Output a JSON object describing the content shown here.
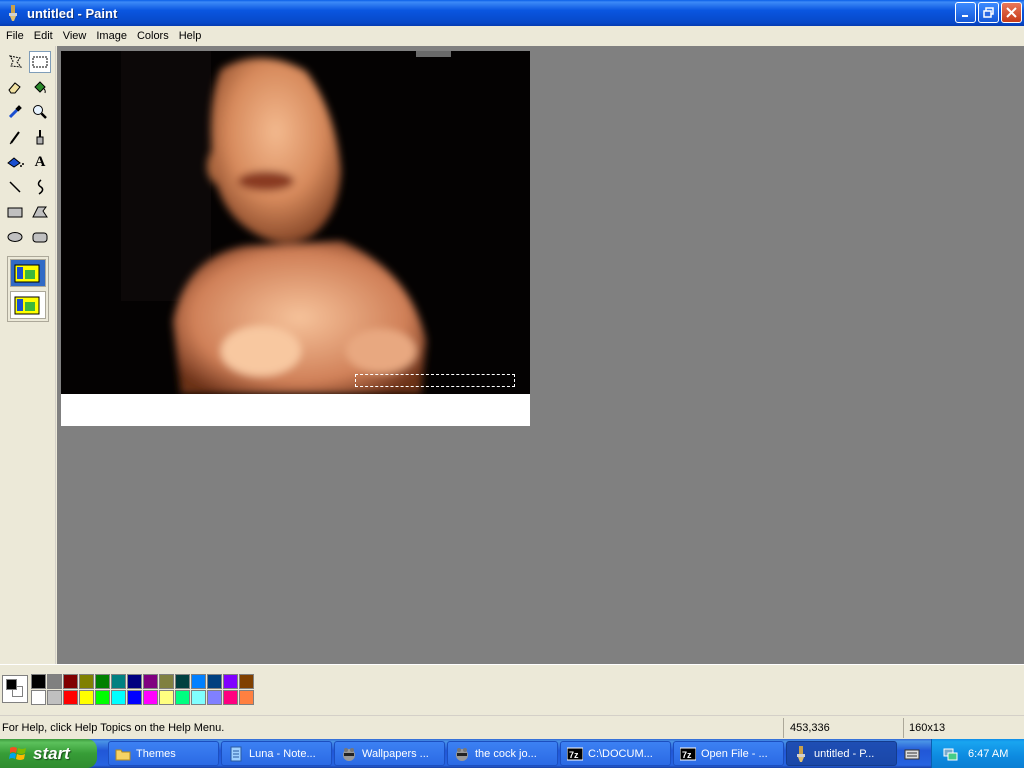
{
  "window": {
    "title": "untitled - Paint",
    "icon": "paint-app-icon"
  },
  "menu": [
    "File",
    "Edit",
    "View",
    "Image",
    "Colors",
    "Help"
  ],
  "tools": [
    {
      "name": "free-form-select",
      "icon": "free-form-select-icon"
    },
    {
      "name": "select",
      "icon": "rect-select-icon",
      "selected": true
    },
    {
      "name": "eraser",
      "icon": "eraser-icon"
    },
    {
      "name": "fill-with-color",
      "icon": "fill-bucket-icon"
    },
    {
      "name": "pick-color",
      "icon": "eyedropper-icon"
    },
    {
      "name": "magnifier",
      "icon": "magnifier-icon"
    },
    {
      "name": "pencil",
      "icon": "pencil-icon"
    },
    {
      "name": "brush",
      "icon": "brush-icon"
    },
    {
      "name": "airbrush",
      "icon": "airbrush-icon"
    },
    {
      "name": "text",
      "icon": "text-icon",
      "glyph": "A"
    },
    {
      "name": "line",
      "icon": "line-icon"
    },
    {
      "name": "curve",
      "icon": "curve-icon"
    },
    {
      "name": "rectangle",
      "icon": "rectangle-icon"
    },
    {
      "name": "polygon",
      "icon": "polygon-icon"
    },
    {
      "name": "ellipse",
      "icon": "ellipse-icon"
    },
    {
      "name": "rounded-rectangle",
      "icon": "rounded-rectangle-icon"
    }
  ],
  "palette": {
    "foreground": "#000000",
    "background": "#ffffff",
    "colors_top": [
      "#000000",
      "#808080",
      "#800000",
      "#808000",
      "#008000",
      "#008080",
      "#000080",
      "#800080",
      "#808040",
      "#004040",
      "#0080ff",
      "#004080",
      "#8000ff",
      "#804000"
    ],
    "colors_bottom": [
      "#ffffff",
      "#c0c0c0",
      "#ff0000",
      "#ffff00",
      "#00ff00",
      "#00ffff",
      "#0000ff",
      "#ff00ff",
      "#ffff80",
      "#00ff80",
      "#80ffff",
      "#8080ff",
      "#ff0080",
      "#ff8040"
    ]
  },
  "status": {
    "help": "For Help, click Help Topics on the Help Menu.",
    "position": "453,336",
    "size": "160x13"
  },
  "taskbar": {
    "start_label": "start",
    "tasks": [
      {
        "label": "Themes",
        "icon": "folder-icon"
      },
      {
        "label": "Luna - Note...",
        "icon": "notepad-icon"
      },
      {
        "label": "Wallpapers ...",
        "icon": "raccoon-icon"
      },
      {
        "label": "the cock jo...",
        "icon": "raccoon-icon"
      },
      {
        "label": "C:\\DOCUM...",
        "icon": "7zip-icon"
      },
      {
        "label": "Open File - ...",
        "icon": "7zip-icon"
      },
      {
        "label": "untitled - P...",
        "icon": "paint-app-icon",
        "active": true
      }
    ],
    "clock": "6:47 AM"
  }
}
